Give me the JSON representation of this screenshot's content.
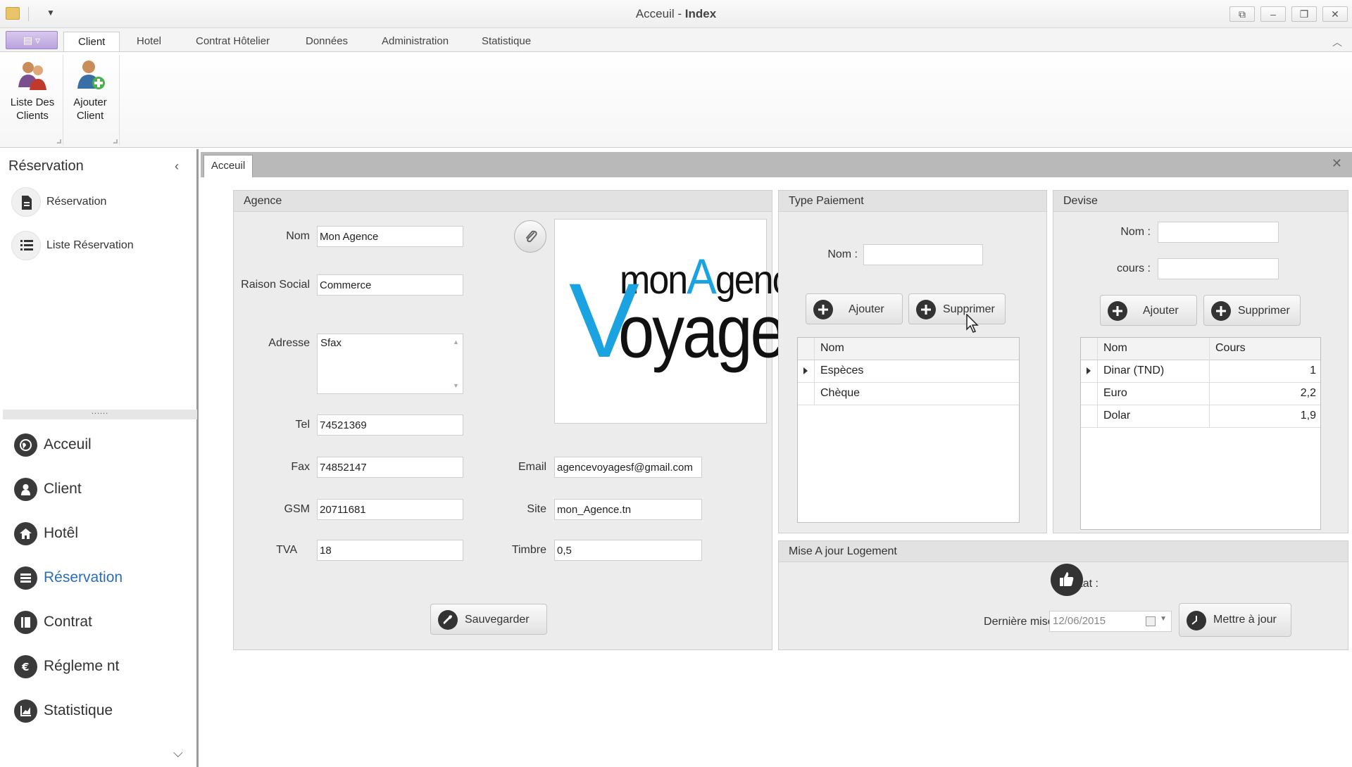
{
  "window": {
    "title_prefix": "Acceuil - ",
    "title_bold": "Index",
    "controls": [
      "⧉",
      "–",
      "❐",
      "✕"
    ]
  },
  "ribbon": {
    "tabs": [
      "Client",
      "Hotel",
      "Contrat Hôtelier",
      "Données",
      "Administration",
      "Statistique"
    ],
    "active_tab": "Client",
    "buttons": [
      {
        "label": "Liste Des Clients",
        "icon": "clients-group-icon"
      },
      {
        "label": "Ajouter Client",
        "icon": "add-client-icon"
      }
    ]
  },
  "left_panel": {
    "title": "Réservation",
    "items": [
      {
        "label": "Réservation",
        "icon": "document-icon"
      },
      {
        "label": "Liste Réservation",
        "icon": "list-icon"
      }
    ],
    "splitter": "......",
    "nav": [
      {
        "label": "Acceuil",
        "icon": "globe-icon",
        "active": false
      },
      {
        "label": "Client",
        "icon": "user-icon",
        "active": false
      },
      {
        "label": "Hotêl",
        "icon": "home-icon",
        "active": false
      },
      {
        "label": "Réservation",
        "icon": "list-icon",
        "active": true
      },
      {
        "label": "Contrat",
        "icon": "book-icon",
        "active": false
      },
      {
        "label": "Régleme nt",
        "icon": "euro-icon",
        "active": false
      },
      {
        "label": "Statistique",
        "icon": "chart-icon",
        "active": false
      }
    ]
  },
  "doc_tab": {
    "label": "Acceuil",
    "close": "✕"
  },
  "agence": {
    "title": "Agence",
    "nom_label": "Nom",
    "nom": "Mon Agence",
    "raison_label": "Raison Social",
    "raison": "Commerce",
    "adresse_label": "Adresse",
    "adresse": "Sfax",
    "tel_label": "Tel",
    "tel": "74521369",
    "fax_label": "Fax",
    "fax": "74852147",
    "gsm_label": "GSM",
    "gsm": "20711681",
    "tva_label": "TVA",
    "tva": "18",
    "email_label": "Email",
    "email": "agencevoyagesf@gmail.com",
    "site_label": "Site",
    "site": "mon_Agence.tn",
    "timbre_label": "Timbre",
    "timbre": "0,5",
    "save_label": "Sauvegarder",
    "logo": {
      "line1_prefix": "mon",
      "line1_a": "A",
      "line1_suffix": "gence",
      "line2_v": "V",
      "line2_rest": "oyages",
      "accent": "#1aa3e0"
    }
  },
  "type_paiement": {
    "title": "Type Paiement",
    "nom_label": "Nom :",
    "nom_value": "",
    "add_label": "Ajouter",
    "delete_label": "Supprimer",
    "grid_header": "Nom",
    "rows": [
      "Espèces",
      "Chèque"
    ]
  },
  "devise": {
    "title": "Devise",
    "nom_label": "Nom :",
    "cours_label": "cours :",
    "add_label": "Ajouter",
    "delete_label": "Supprimer",
    "headers": [
      "Nom",
      "Cours"
    ],
    "rows": [
      {
        "nom": "Dinar (TND)",
        "cours": "1"
      },
      {
        "nom": "Euro",
        "cours": "2,2"
      },
      {
        "nom": "Dolar",
        "cours": "1,9"
      }
    ]
  },
  "logement": {
    "title": "Mise A jour Logement",
    "etat_label": "Etat :",
    "last_update_label": "Dernière mise à jour :",
    "last_update_value": "12/06/2015",
    "update_label": "Mettre à jour"
  }
}
